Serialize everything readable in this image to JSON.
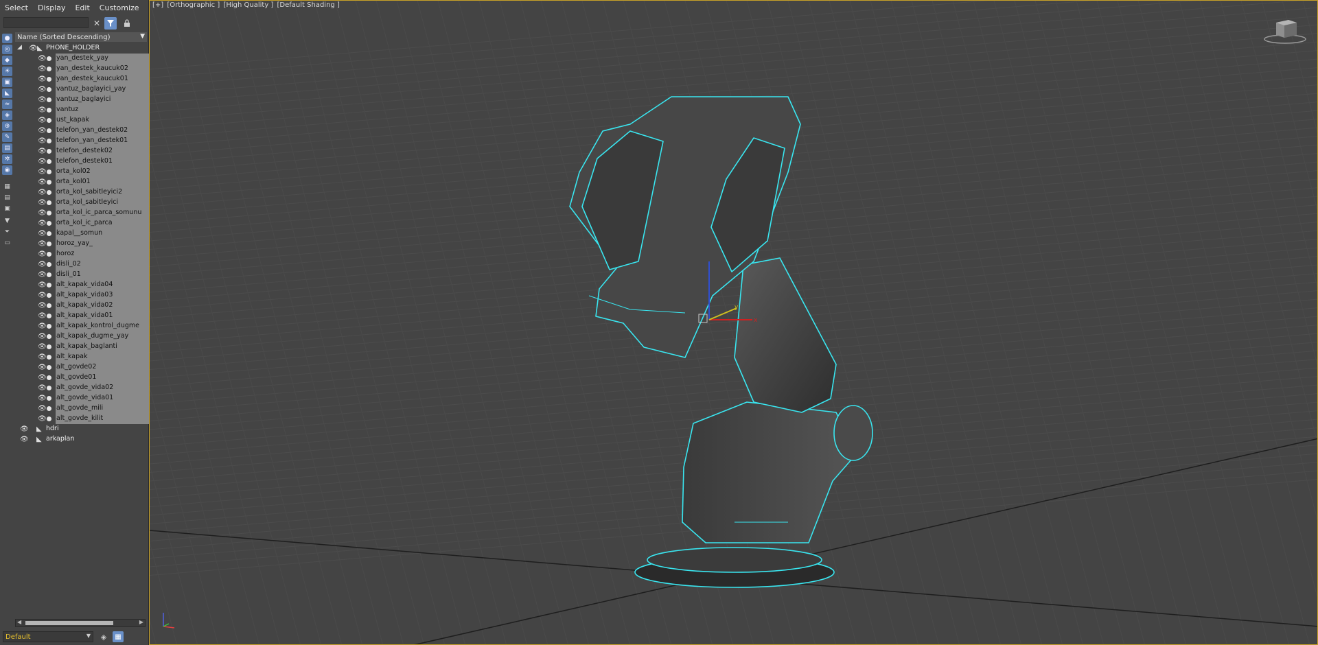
{
  "menu": [
    "Select",
    "Display",
    "Edit",
    "Customize"
  ],
  "search": {
    "value": "",
    "placeholder": ""
  },
  "tree_header": "Name (Sorted Descending)",
  "root": "PHONE_HOLDER",
  "children": [
    "yan_destek_yay",
    "yan_destek_kaucuk02",
    "yan_destek_kaucuk01",
    "vantuz_baglayici_yay",
    "vantuz_baglayici",
    "vantuz",
    "ust_kapak",
    "telefon_yan_destek02",
    "telefon_yan_destek01",
    "telefon_destek02",
    "telefon_destek01",
    "orta_kol02",
    "orta_kol01",
    "orta_kol_sabitleyici2",
    "orta_kol_sabitleyici",
    "orta_kol_ic_parca_somunu",
    "orta_kol_ic_parca",
    "kapal__somun",
    "horoz_yay_",
    "horoz",
    "disli_02",
    "disli_01",
    "alt_kapak_vida04",
    "alt_kapak_vida03",
    "alt_kapak_vida02",
    "alt_kapak_vida01",
    "alt_kapak_kontrol_dugme",
    "alt_kapak_dugme_yay",
    "alt_kapak_baglanti",
    "alt_kapak",
    "alt_govde02",
    "alt_govde01",
    "alt_govde_vida02",
    "alt_govde_vida01",
    "alt_govde_mili",
    "alt_govde_kilit"
  ],
  "other_roots": [
    "hdri",
    "arkaplan"
  ],
  "layer": "Default",
  "viewport_label": [
    "[+]",
    "[Orthographic ]",
    "[High Quality ]",
    "[Default Shading ]"
  ],
  "gizmo_labels": {
    "x": "x",
    "y": "y"
  },
  "colors": {
    "accent_blue": "#6a90c8",
    "selection_outline": "#39e6f0",
    "viewport_border": "#c9a227",
    "layer_text": "#e6c02e"
  },
  "icons": {
    "clear": "close-icon",
    "filter": "filter-icon",
    "lock": "lock-icon",
    "visibility": "eye-icon",
    "object": "object-icon"
  }
}
